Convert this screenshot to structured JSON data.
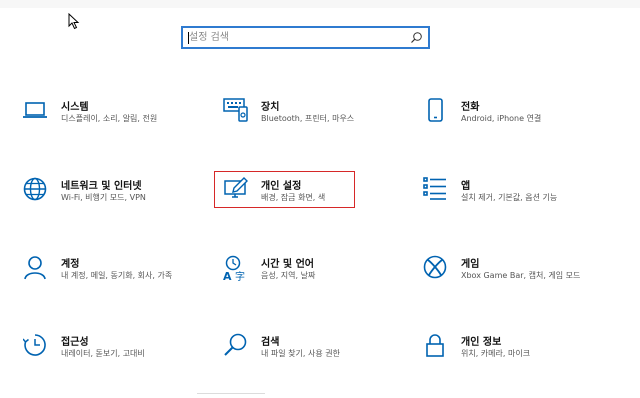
{
  "search": {
    "placeholder": "설정 검색",
    "value": ""
  },
  "accent": "#0063b1",
  "highlight_color": "#d62828",
  "tiles": [
    {
      "icon": "laptop-icon",
      "title": "시스템",
      "desc": "디스플레이, 소리, 알림, 전원"
    },
    {
      "icon": "keyboard-device-icon",
      "title": "장치",
      "desc": "Bluetooth, 프린터, 마우스"
    },
    {
      "icon": "phone-icon",
      "title": "전화",
      "desc": "Android, iPhone 연결"
    },
    {
      "icon": "globe-icon",
      "title": "네트워크 및 인터넷",
      "desc": "Wi-Fi, 비행기 모드, VPN"
    },
    {
      "icon": "personalization-icon",
      "title": "개인 설정",
      "desc": "배경, 잠금 화면, 색"
    },
    {
      "icon": "apps-list-icon",
      "title": "앱",
      "desc": "설치 제거, 기본값, 옵션 기능"
    },
    {
      "icon": "person-icon",
      "title": "계정",
      "desc": "내 계정, 메일, 동기화, 회사, 가족"
    },
    {
      "icon": "time-language-icon",
      "title": "시간 및 언어",
      "desc": "음성, 지역, 날짜"
    },
    {
      "icon": "xbox-icon",
      "title": "게임",
      "desc": "Xbox Game Bar, 캡처, 게임 모드"
    },
    {
      "icon": "ease-of-access-icon",
      "title": "접근성",
      "desc": "내레이터, 돋보기, 고대비"
    },
    {
      "icon": "search-icon",
      "title": "검색",
      "desc": "내 파일 찾기, 사용 권한"
    },
    {
      "icon": "lock-icon",
      "title": "개인 정보",
      "desc": "위치, 카메라, 마이크"
    }
  ]
}
